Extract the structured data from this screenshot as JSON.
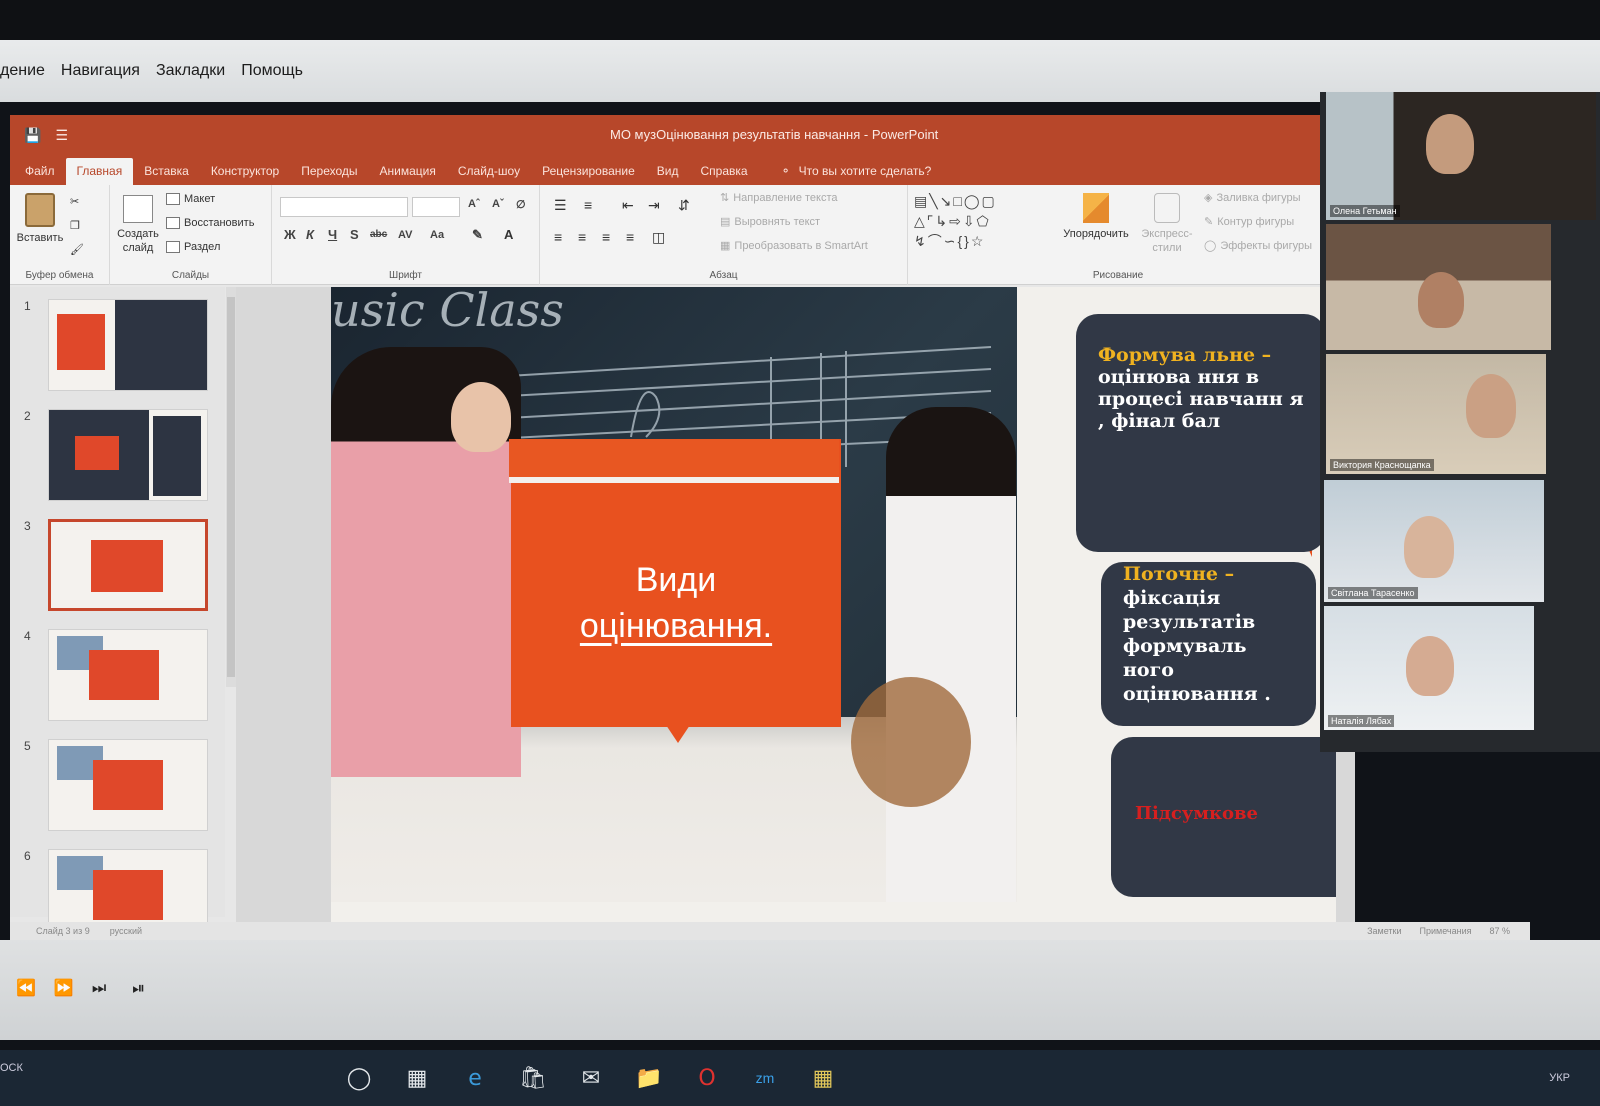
{
  "viewer_menu": [
    "дение",
    "Навигация",
    "Закладки",
    "Помощь"
  ],
  "window": {
    "title": "МО музОцінювання результатів навчання  -  PowerPoint"
  },
  "ribbon_tabs": [
    "Файл",
    "Главная",
    "Вставка",
    "Конструктор",
    "Переходы",
    "Анимация",
    "Слайд-шоу",
    "Рецензирование",
    "Вид",
    "Справка"
  ],
  "active_tab": "Главная",
  "tell_me": "Что вы хотите сделать?",
  "ribbon": {
    "clipboard": {
      "paste": "Вставить",
      "group": "Буфер обмена"
    },
    "slides": {
      "new_slide_line1": "Создать",
      "new_slide_line2": "слайд",
      "layout": "Макет",
      "reset": "Восстановить",
      "section": "Раздел",
      "group": "Слайды"
    },
    "font": {
      "group": "Шрифт",
      "bold": "Ж",
      "italic": "К",
      "underline": "Ч",
      "shadow": "S",
      "strike": "abc",
      "spacing": "AV",
      "case": "Aa"
    },
    "paragraph": {
      "group": "Абзац",
      "text_direction": "Направление текста",
      "align_text": "Выровнять текст",
      "smartart": "Преобразовать в SmartArt"
    },
    "drawing": {
      "group": "Рисование",
      "arrange": "Упорядочить",
      "quick_styles_line1": "Экспресс-",
      "quick_styles_line2": "стили",
      "shape_fill": "Заливка фигуры",
      "shape_outline": "Контур фигуры",
      "shape_effects": "Эффекты фигуры"
    }
  },
  "thumbnails": [
    {
      "num": "1"
    },
    {
      "num": "2"
    },
    {
      "num": "3",
      "selected": true
    },
    {
      "num": "4"
    },
    {
      "num": "5"
    },
    {
      "num": "6"
    }
  ],
  "slide": {
    "board_text": "usic Class",
    "title_line1": "Види",
    "title_line2": "оцінювання.",
    "callout1_highlight": "Формува льне –",
    "callout1_body": "оцінюва ння в процесі навчанн я , фінал бал",
    "callout2_highlight": "Поточне –",
    "callout2_body": "фіксація результатів формуваль ного оцінювання .",
    "callout3": "Підсумкове"
  },
  "participants": [
    {
      "name": "Олена Гетьман"
    },
    {
      "name": ""
    },
    {
      "name": "Виктория Краснощапка"
    },
    {
      "name": "Світлана Тарасенко"
    },
    {
      "name": "Наталія Лябах"
    }
  ],
  "statusbar": {
    "slide_info": "Слайд 3 из 9",
    "language": "русский",
    "notes": "Заметки",
    "comments": "Примечания",
    "zoom": "87 %"
  },
  "taskbar": {
    "left": "ОСК",
    "lang": "УКР"
  },
  "colors": {
    "pp_red": "#b7472a",
    "slide_orange": "#e8511f",
    "callout_dark": "#313846",
    "highlight_yellow": "#f0b220"
  }
}
